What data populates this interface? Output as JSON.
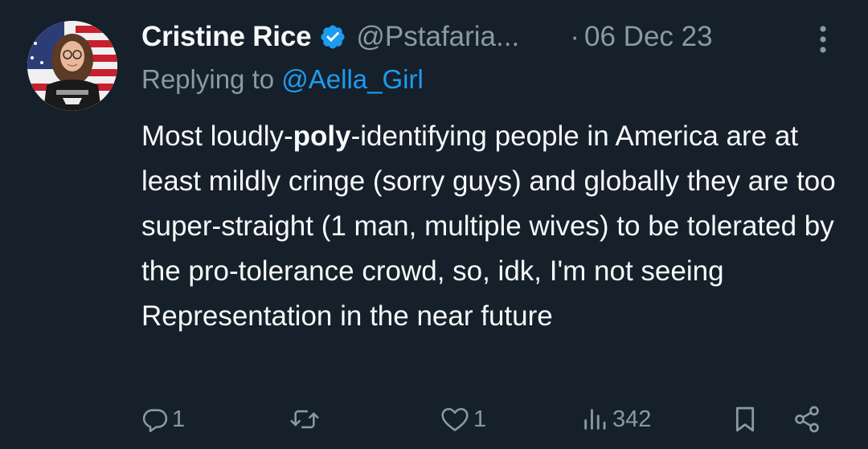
{
  "tweet": {
    "display_name": "Cristine Rice",
    "handle": "@Pstafaria...",
    "separator": "·",
    "date": "06 Dec 23",
    "replying_prefix": "Replying to ",
    "replying_to": "@Aella_Girl",
    "text_before_bold": "Most loudly-",
    "text_bold": "poly",
    "text_after_bold": "-identifying people in America are at least mildly cringe (sorry guys) and globally they are too super-straight (1 man, multiple wives) to be tolerated by the pro-tolerance crowd, so, idk, I'm not seeing Representation in the near future",
    "verified_color": "#1d9bf0"
  },
  "actions": {
    "reply_count": "1",
    "retweet_count": "",
    "like_count": "1",
    "views_count": "342",
    "icons": [
      "reply-icon",
      "retweet-icon",
      "like-icon",
      "views-icon",
      "bookmark-icon",
      "share-icon"
    ]
  },
  "colors": {
    "background": "#15202b",
    "primary_text": "#f7f9f9",
    "secondary_text": "#8b98a5",
    "accent": "#1d9bf0"
  }
}
